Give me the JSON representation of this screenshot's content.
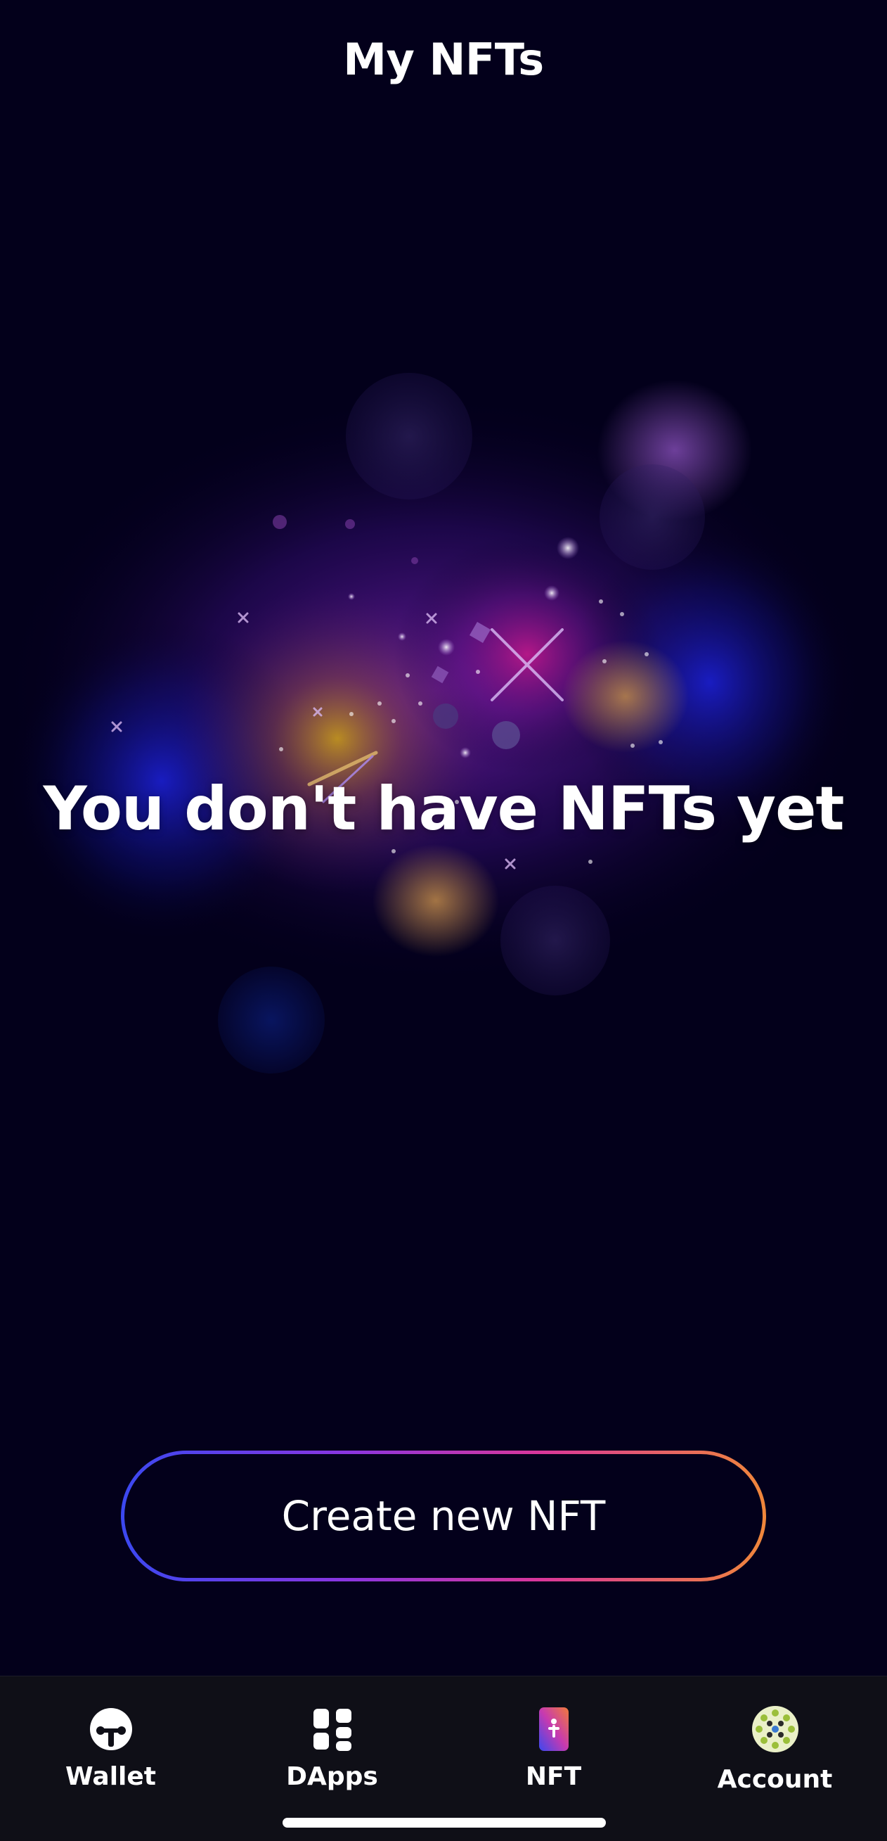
{
  "header": {
    "title": "My NFTs"
  },
  "empty_state": {
    "message": "You don't have NFTs yet",
    "illustration": "galaxy-nebula"
  },
  "actions": {
    "create_label": "Create new NFT"
  },
  "nav": {
    "items": [
      {
        "label": "Wallet",
        "icon": "wallet-shield-icon"
      },
      {
        "label": "DApps",
        "icon": "dapps-grid-icon"
      },
      {
        "label": "NFT",
        "icon": "nft-card-icon"
      },
      {
        "label": "Account",
        "icon": "account-avatar-icon"
      }
    ],
    "active": "NFT"
  },
  "colors": {
    "background": "#03001b",
    "nav_background": "#0f0f17",
    "button_gradient": [
      "#3b48f0",
      "#8a35e0",
      "#d9369a",
      "#f0873a"
    ]
  }
}
